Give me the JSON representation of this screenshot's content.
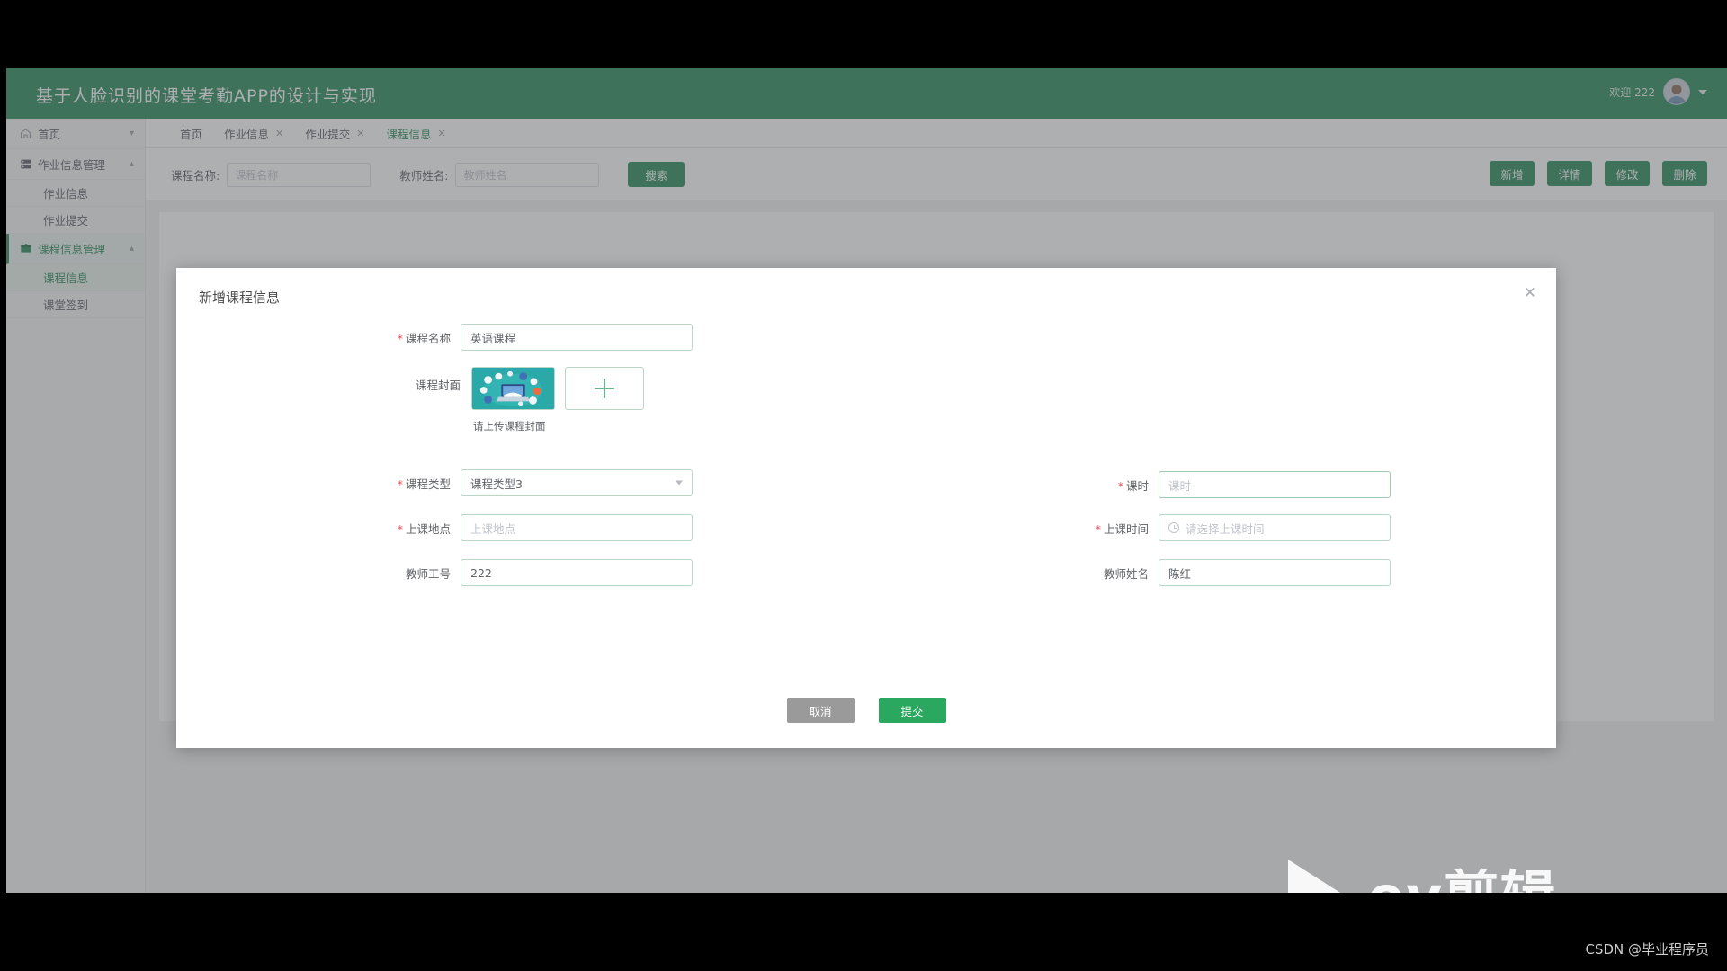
{
  "header": {
    "title": "基于人脸识别的课堂考勤APP的设计与实现",
    "welcome": "欢迎 222",
    "avatar_icon": "user-avatar",
    "caret_icon": "chevron-down-icon"
  },
  "sidebar": {
    "home": {
      "label": "首页",
      "icon": "home-icon",
      "arrow": "chevron-down-icon"
    },
    "groups": [
      {
        "label": "作业信息管理",
        "icon": "list-icon",
        "arrow": "chevron-up-icon",
        "active": false,
        "children": [
          {
            "label": "作业信息",
            "active": false
          },
          {
            "label": "作业提交",
            "active": false
          }
        ]
      },
      {
        "label": "课程信息管理",
        "icon": "book-icon",
        "arrow": "chevron-up-icon",
        "active": true,
        "children": [
          {
            "label": "课程信息",
            "active": true
          },
          {
            "label": "课堂签到",
            "active": false
          }
        ]
      }
    ]
  },
  "tabs": [
    {
      "label": "首页",
      "closable": false,
      "active": false
    },
    {
      "label": "作业信息",
      "closable": true,
      "active": false
    },
    {
      "label": "作业提交",
      "closable": true,
      "active": false
    },
    {
      "label": "课程信息",
      "closable": true,
      "active": true
    }
  ],
  "search": {
    "course_name_label": "课程名称:",
    "course_name_placeholder": "课程名称",
    "teacher_name_label": "教师姓名:",
    "teacher_name_placeholder": "教师姓名",
    "search_button": "搜索"
  },
  "toolbar": {
    "add": "新增",
    "detail": "详情",
    "edit": "修改",
    "delete": "删除"
  },
  "modal": {
    "title": "新增课程信息",
    "close_icon": "close-icon",
    "fields": {
      "course_name": {
        "label": "课程名称",
        "required": true,
        "value": "英语课程"
      },
      "course_cover": {
        "label": "课程封面",
        "required": false,
        "hint": "请上传课程封面",
        "add_icon": "plus-icon",
        "thumbnail_alt": "course-cover-thumbnail"
      },
      "course_type": {
        "label": "课程类型",
        "required": true,
        "value": "课程类型3",
        "chevron_icon": "chevron-down-icon"
      },
      "class_hours": {
        "label": "课时",
        "required": true,
        "value": "",
        "placeholder": "课时"
      },
      "class_place": {
        "label": "上课地点",
        "required": true,
        "value": "",
        "placeholder": "上课地点"
      },
      "class_time": {
        "label": "上课时间",
        "required": true,
        "value": "",
        "placeholder": "请选择上课时间",
        "icon": "clock-icon"
      },
      "teacher_id": {
        "label": "教师工号",
        "required": false,
        "value": "222"
      },
      "teacher_name": {
        "label": "教师姓名",
        "required": false,
        "value": "陈红"
      }
    },
    "buttons": {
      "cancel": "取消",
      "submit": "提交"
    }
  },
  "watermark": {
    "text": "ev剪辑",
    "play_icon": "play-triangle-icon"
  },
  "footer": {
    "credit": "CSDN @毕业程序员"
  },
  "colors": {
    "brand_green": "#2b8a5a",
    "submit_green": "#2aa85f",
    "cancel_gray": "#9a9a9a",
    "required_red": "#e8505b",
    "input_border": "#b9d6c6"
  }
}
